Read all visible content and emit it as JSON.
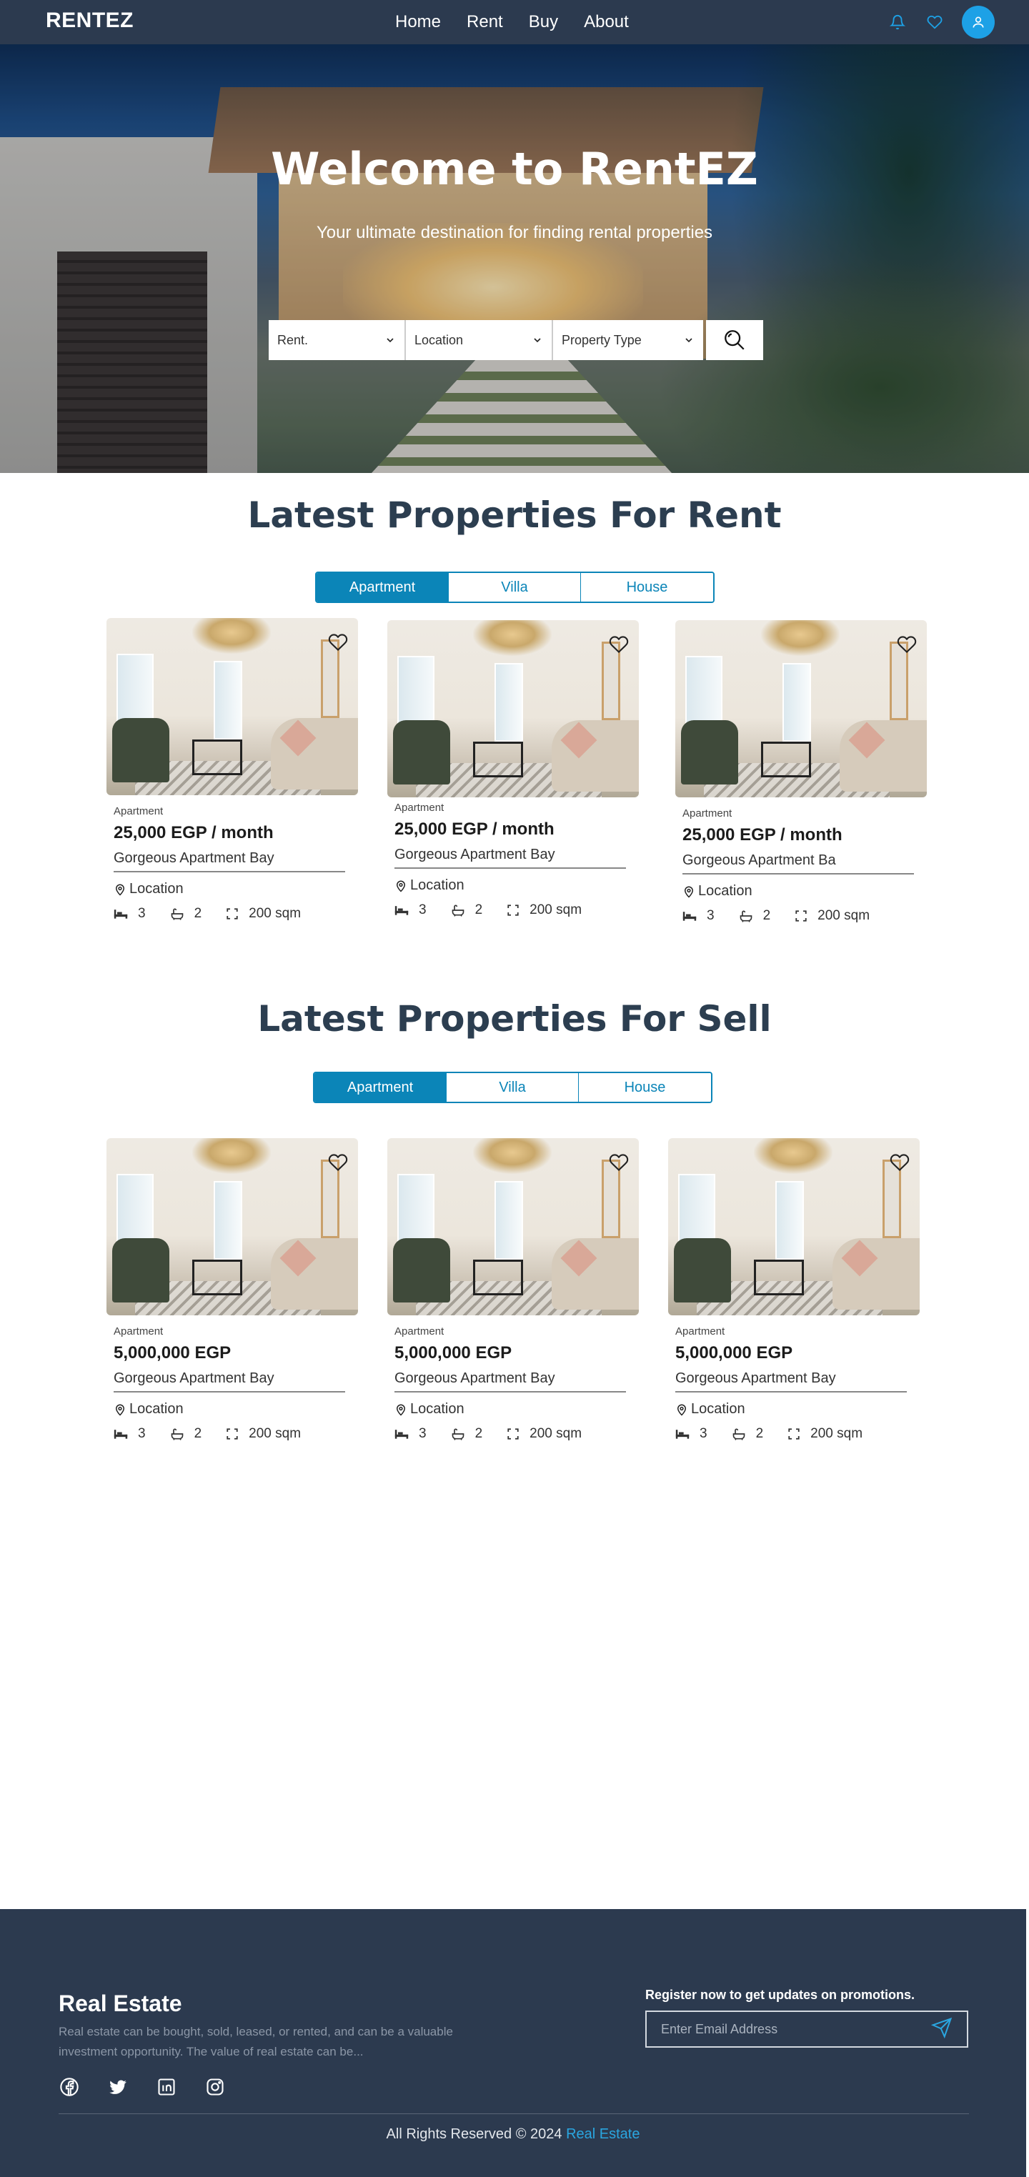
{
  "navbar": {
    "brand": "RENTEZ",
    "links": [
      "Home",
      "Rent",
      "Buy",
      "About"
    ],
    "icons": [
      "bell-icon",
      "heart-icon",
      "user-icon"
    ]
  },
  "hero": {
    "title": "Welcome to RentEZ",
    "subtitle": "Your ultimate destination for finding rental properties",
    "search": {
      "type_value": "Rent.",
      "location_value": "Location",
      "property_type_value": "Property Type"
    }
  },
  "rent": {
    "title": "Latest Properties For Rent",
    "tabs": [
      "Apartment",
      "Villa",
      "House"
    ],
    "active_tab": "Apartment",
    "cards": [
      {
        "type": "Apartment",
        "price": "25,000 EGP / month",
        "name": "Gorgeous Apartment Bay",
        "location": "Location",
        "beds": "3",
        "baths": "2",
        "area": "200 sqm"
      },
      {
        "type": "Apartment",
        "price": "25,000 EGP / month",
        "name": "Gorgeous Apartment Bay",
        "location": "Location",
        "beds": "3",
        "baths": "2",
        "area": "200 sqm"
      },
      {
        "type": "Apartment",
        "price": "25,000 EGP / month",
        "name": "Gorgeous Apartment Ba",
        "location": "Location",
        "beds": "3",
        "baths": "2",
        "area": "200 sqm"
      }
    ]
  },
  "sell": {
    "title": "Latest Properties For Sell",
    "tabs": [
      "Apartment",
      "Villa",
      "House"
    ],
    "active_tab": "Apartment",
    "cards": [
      {
        "type": "Apartment",
        "price": "5,000,000 EGP",
        "name": "Gorgeous Apartment Bay",
        "location": "Location",
        "beds": "3",
        "baths": "2",
        "area": "200 sqm"
      },
      {
        "type": "Apartment",
        "price": "5,000,000 EGP",
        "name": "Gorgeous Apartment Bay",
        "location": "Location",
        "beds": "3",
        "baths": "2",
        "area": "200 sqm"
      },
      {
        "type": "Apartment",
        "price": "5,000,000 EGP",
        "name": "Gorgeous Apartment Bay",
        "location": "Location",
        "beds": "3",
        "baths": "2",
        "area": "200 sqm"
      }
    ]
  },
  "footer": {
    "brand": "Real Estate",
    "description": "Real estate can be bought, sold, leased, or rented, and can be a valuable investment opportunity. The value of real estate can be...",
    "social": [
      "facebook-icon",
      "twitter-icon",
      "linkedin-icon",
      "instagram-icon"
    ],
    "register_text": "Register now to get updates on promotions.",
    "email_placeholder": "Enter Email Address",
    "copyright_prefix": "All Rights Reserved ©  2024",
    "copyright_link": "Real Estate"
  },
  "colors": {
    "navbar": "#2c3a4f",
    "accent": "#0b85b8",
    "avatar": "#1da1e6",
    "footer": "#2c3a4f",
    "link": "#2aa6e0"
  }
}
